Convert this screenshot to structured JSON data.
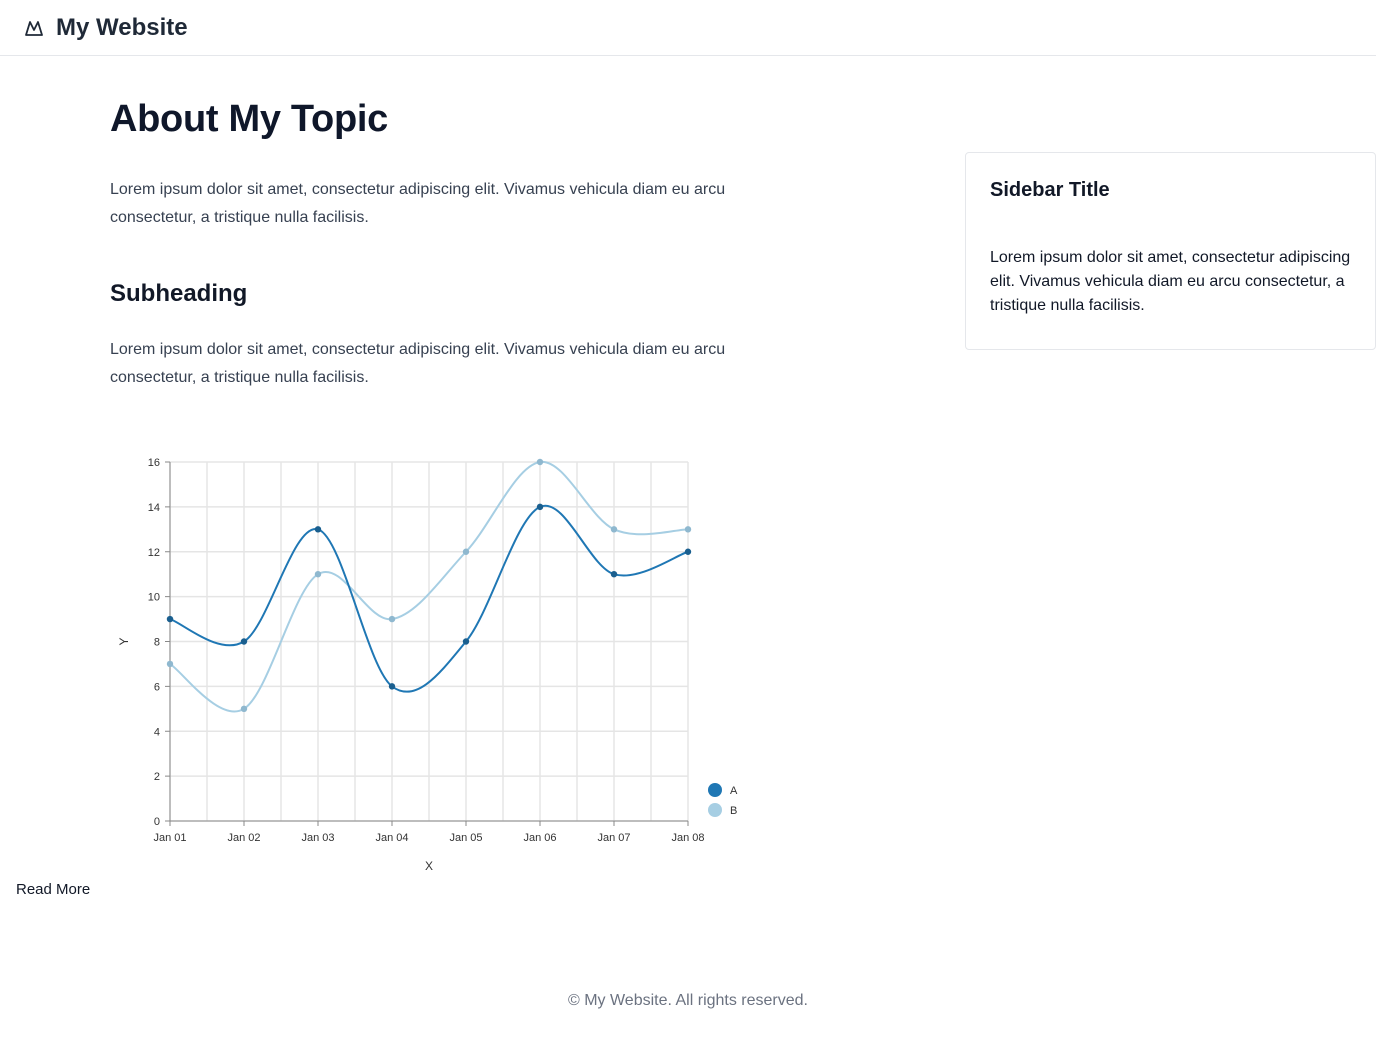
{
  "header": {
    "site_name": "My Website",
    "logo_icon": "mountain-icon"
  },
  "main": {
    "title": "About My Topic",
    "intro": "Lorem ipsum dolor sit amet, consectetur adipiscing elit. Vivamus vehicula diam eu arcu consectetur, a tristique nulla facilisis.",
    "subheading": "Subheading",
    "body": "Lorem ipsum dolor sit amet, consectetur adipiscing elit. Vivamus vehicula diam eu arcu consectetur, a tristique nulla facilisis.",
    "read_more": "Read More"
  },
  "sidebar": {
    "title": "Sidebar Title",
    "text": "Lorem ipsum dolor sit amet, consectetur adipiscing elit. Vivamus vehicula diam eu arcu consectetur, a tristique nulla facilisis."
  },
  "footer": {
    "text": "© My Website. All rights reserved."
  },
  "chart_data": {
    "type": "line",
    "categories": [
      "Jan 01",
      "Jan 02",
      "Jan 03",
      "Jan 04",
      "Jan 05",
      "Jan 06",
      "Jan 07",
      "Jan 08"
    ],
    "series": [
      {
        "name": "A",
        "values": [
          9,
          8,
          13,
          6,
          8,
          14,
          11,
          12
        ],
        "color": "#1f77b4"
      },
      {
        "name": "B",
        "values": [
          7,
          5,
          11,
          9,
          12,
          16,
          13,
          13
        ],
        "color": "#a6cee3"
      }
    ],
    "xlabel": "X",
    "ylabel": "Y",
    "ylim": [
      0,
      16
    ],
    "yticks": [
      0,
      2,
      4,
      6,
      8,
      10,
      12,
      14,
      16
    ],
    "grid": true,
    "legend": "bottom-right"
  }
}
